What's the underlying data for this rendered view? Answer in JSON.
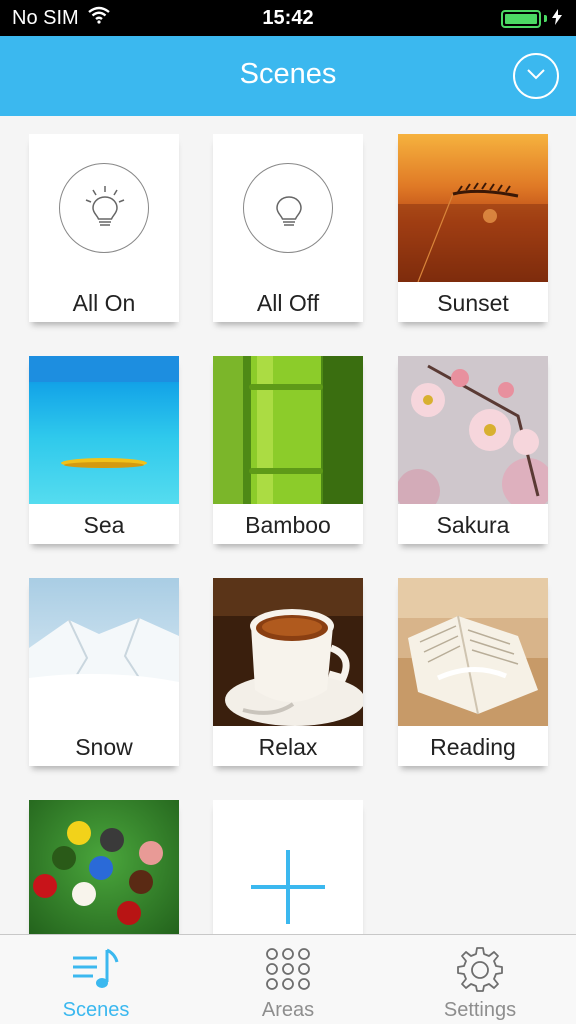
{
  "status_bar": {
    "carrier": "No SIM",
    "time": "15:42",
    "battery_level": 1.0,
    "wifi_icon": "wifi-icon",
    "charging_icon": "bolt-icon"
  },
  "nav": {
    "title": "Scenes",
    "dropdown_icon": "chevron-down-icon",
    "accent_color": "#3bb8ef"
  },
  "scenes": [
    {
      "label": "All On",
      "kind": "all-on"
    },
    {
      "label": "All Off",
      "kind": "all-off"
    },
    {
      "label": "Sunset",
      "kind": "photo"
    },
    {
      "label": "Sea",
      "kind": "photo"
    },
    {
      "label": "Bamboo",
      "kind": "photo"
    },
    {
      "label": "Sakura",
      "kind": "photo"
    },
    {
      "label": "Snow",
      "kind": "photo"
    },
    {
      "label": "Relax",
      "kind": "photo"
    },
    {
      "label": "Reading",
      "kind": "photo"
    },
    {
      "label": "",
      "kind": "photo"
    },
    {
      "label": "",
      "kind": "add"
    }
  ],
  "tab_bar": {
    "tabs": [
      {
        "label": "Scenes",
        "icon": "music-list-icon",
        "active": true
      },
      {
        "label": "Areas",
        "icon": "grid-dots-icon",
        "active": false
      },
      {
        "label": "Settings",
        "icon": "gear-icon",
        "active": false
      }
    ]
  }
}
